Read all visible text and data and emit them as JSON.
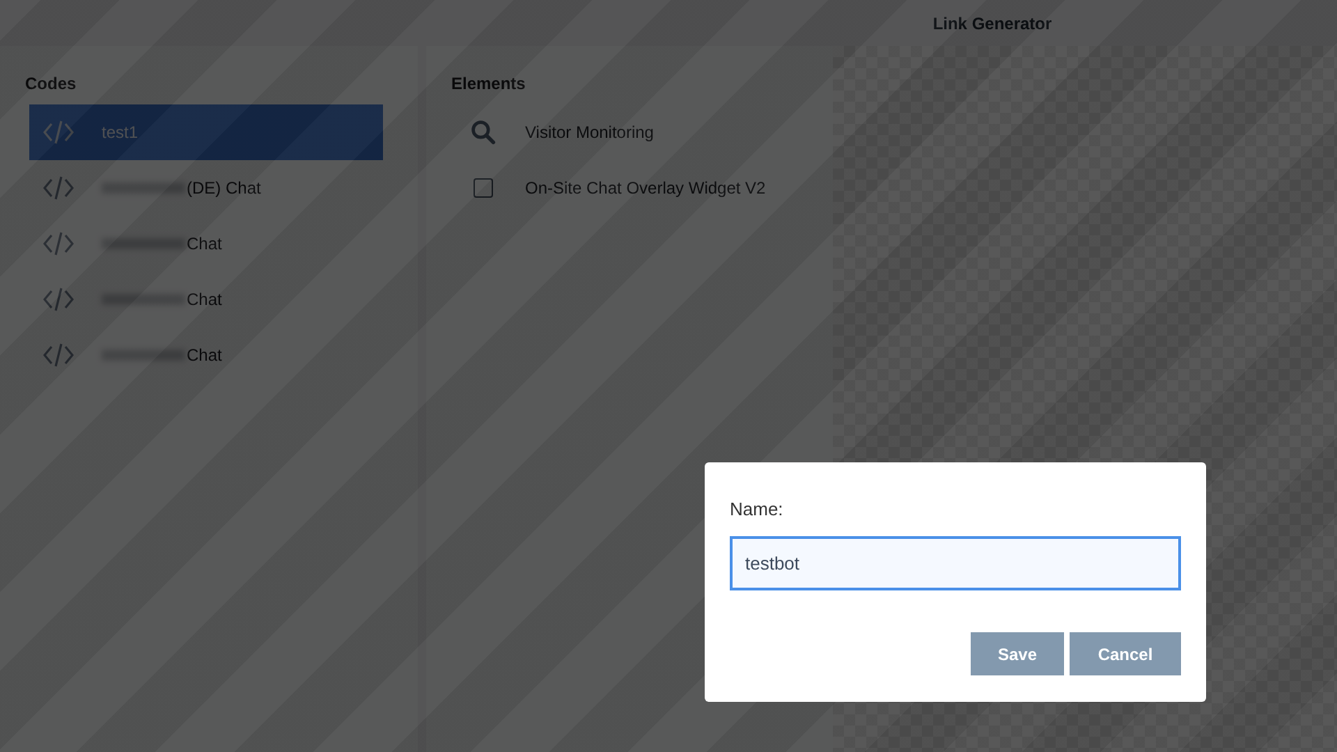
{
  "header": {
    "title": "Link Generator"
  },
  "codes": {
    "title": "Codes",
    "items": [
      {
        "label": "test1",
        "redacted": false,
        "selected": true
      },
      {
        "label": "(DE) Chat",
        "redacted": true,
        "selected": false
      },
      {
        "label": "Chat",
        "redacted": true,
        "selected": false
      },
      {
        "label": "Chat",
        "redacted": true,
        "selected": false
      },
      {
        "label": "Chat",
        "redacted": true,
        "selected": false
      }
    ]
  },
  "elements": {
    "title": "Elements",
    "items": [
      {
        "kind": "search",
        "label": "Visitor Monitoring"
      },
      {
        "kind": "checkbox",
        "label": "On-Site Chat Overlay Widget V2",
        "checked": false
      }
    ]
  },
  "dialog": {
    "label": "Name:",
    "value": "testbot",
    "buttons": [
      "Save",
      "Cancel"
    ]
  }
}
